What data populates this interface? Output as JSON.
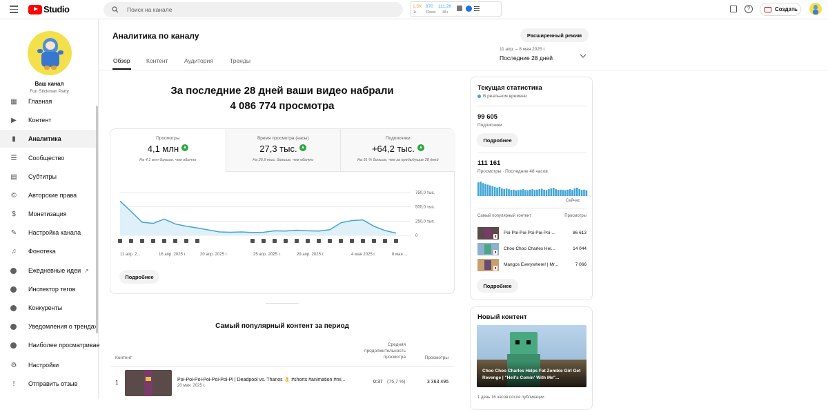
{
  "topbar": {
    "logo_text": "Studio",
    "search_placeholder": "Поиск на канале",
    "stats_widget": {
      "v1": "1.5K",
      "v2": "970",
      "v3": "111.2K",
      "sub1": "1г",
      "sub2": "60мин",
      "sub3": "48ч"
    },
    "create_label": "Создать"
  },
  "sidebar": {
    "channel_title": "Ваш канал",
    "channel_name": "Fun Stickman Party",
    "items": [
      {
        "label": "Главная",
        "icon": "dashboard-icon"
      },
      {
        "label": "Контент",
        "icon": "content-icon"
      },
      {
        "label": "Аналитика",
        "icon": "analytics-icon"
      },
      {
        "label": "Сообщество",
        "icon": "community-icon"
      },
      {
        "label": "Субтитры",
        "icon": "subtitles-icon"
      },
      {
        "label": "Авторские права",
        "icon": "copyright-icon"
      },
      {
        "label": "Монетизация",
        "icon": "monetization-icon"
      },
      {
        "label": "Настройка канала",
        "icon": "customization-icon"
      },
      {
        "label": "Фонотека",
        "icon": "audio-library-icon"
      },
      {
        "label": "Ежедневные идеи",
        "icon": "extension-icon"
      },
      {
        "label": "Инспектор тегов",
        "icon": "extension-icon"
      },
      {
        "label": "Конкуренты",
        "icon": "extension-icon"
      },
      {
        "label": "Уведомления о трендах",
        "icon": "extension-icon"
      },
      {
        "label": "Наиболее просматривае",
        "icon": "extension-icon"
      },
      {
        "label": "Настройки",
        "icon": "settings-icon"
      },
      {
        "label": "Отправить отзыв",
        "icon": "feedback-icon"
      }
    ]
  },
  "header": {
    "title": "Аналитика по каналу",
    "advanced_mode": "Расширенный режим",
    "tabs": [
      "Обзор",
      "Контент",
      "Аудитория",
      "Тренды"
    ],
    "date_range": "11 апр. – 8 мая 2025 г.",
    "period": "Последние 28 дней"
  },
  "summary": {
    "line1": "За последние 28 дней ваши видео набрали",
    "line2": "4 086 774 просмотра"
  },
  "metrics": [
    {
      "label": "Просмотры",
      "value": "4,1 млн",
      "note": "На 4,1 млн больше, чем обычно"
    },
    {
      "label": "Время просмотра (часы)",
      "value": "27,3 тыс.",
      "note": "На 26,9 тыс. больше, чем обычно"
    },
    {
      "label": "Подписчики",
      "value": "+64,2 тыс.",
      "note": "На 91 % больше, чем за предыдущие 28 дней"
    }
  ],
  "chart_data": {
    "type": "area",
    "y_ticks": [
      "750,0 тыс.",
      "500,0 тыс.",
      "250,0 тыс.",
      "0"
    ],
    "ylim": [
      0,
      750000
    ],
    "x_labels": [
      "11 апр. 2...",
      "16 апр. 2025 г.",
      "20 апр. 2025 г.",
      "25 апр. 2025 г.",
      "29 апр. 2025 г.",
      "4 мая 2025 г.",
      "8 мая ..."
    ],
    "values": [
      600000,
      420000,
      230000,
      210000,
      285000,
      200000,
      160000,
      130000,
      95000,
      60000,
      55000,
      60000,
      50000,
      55000,
      80000,
      75000,
      90000,
      80000,
      75000,
      100000,
      220000,
      260000,
      270000,
      160000,
      85000,
      40000
    ],
    "color": "#41a5d6"
  },
  "more_button": "Подробнее",
  "top_content": {
    "title": "Самый популярный контент за период",
    "col_content": "Контент",
    "col_duration": "Средняя продолжительность просмотра",
    "col_views": "Просмотры",
    "rows": [
      {
        "rank": "1",
        "title": "Poi-Poi-Poi-Poi-Poi-Poi-Pi | Deadpool vs. Thanos 👌 #shorts #animation #mi...",
        "date": "20 мая. 2025 г.",
        "duration": "0:37",
        "pct": "(75,7 %)",
        "views": "3 363 495"
      }
    ]
  },
  "realtime": {
    "title": "Текущая статистика",
    "live": "В реальном времени",
    "subs_value": "99 605",
    "subs_label": "Подписчики",
    "more": "Подробнее",
    "views_value": "111 161",
    "views_label": "Просмотры · Последние 48 часов",
    "now_label": "Сейчас",
    "bars": [
      0.9,
      0.95,
      0.85,
      0.8,
      0.75,
      0.7,
      0.65,
      0.6,
      0.55,
      0.6,
      0.5,
      0.45,
      0.5,
      0.45,
      0.4,
      0.42,
      0.38,
      0.4,
      0.42,
      0.45,
      0.4,
      0.38,
      0.42,
      0.45,
      0.4,
      0.42,
      0.45,
      0.48,
      0.42,
      0.4,
      0.45,
      0.5,
      0.55,
      0.45,
      0.4,
      0.42,
      0.4,
      0.38,
      0.42,
      0.45,
      0.4,
      0.5,
      0.55,
      0.45,
      0.4,
      0.42,
      0.38
    ],
    "popular_label": "Самый популярный контент",
    "popular_views_label": "Просмотры",
    "items": [
      {
        "title": "Poi-Poi-Poi-Poi-Poi-Poi-...",
        "views": "86 613"
      },
      {
        "title": "Choo Choo Charles Hel...",
        "views": "14 044"
      },
      {
        "title": "Mangos Everywhere! | Mr...",
        "views": "7 066"
      }
    ],
    "more2": "Подробнее"
  },
  "new_content": {
    "title": "Новый контент",
    "video_title": "Choo Choo Charles Helps Fat Zombie Girl Get Revenge | \"Hell's Comin' With Me\"...",
    "footer": "1 день 16 часов после публикации"
  }
}
